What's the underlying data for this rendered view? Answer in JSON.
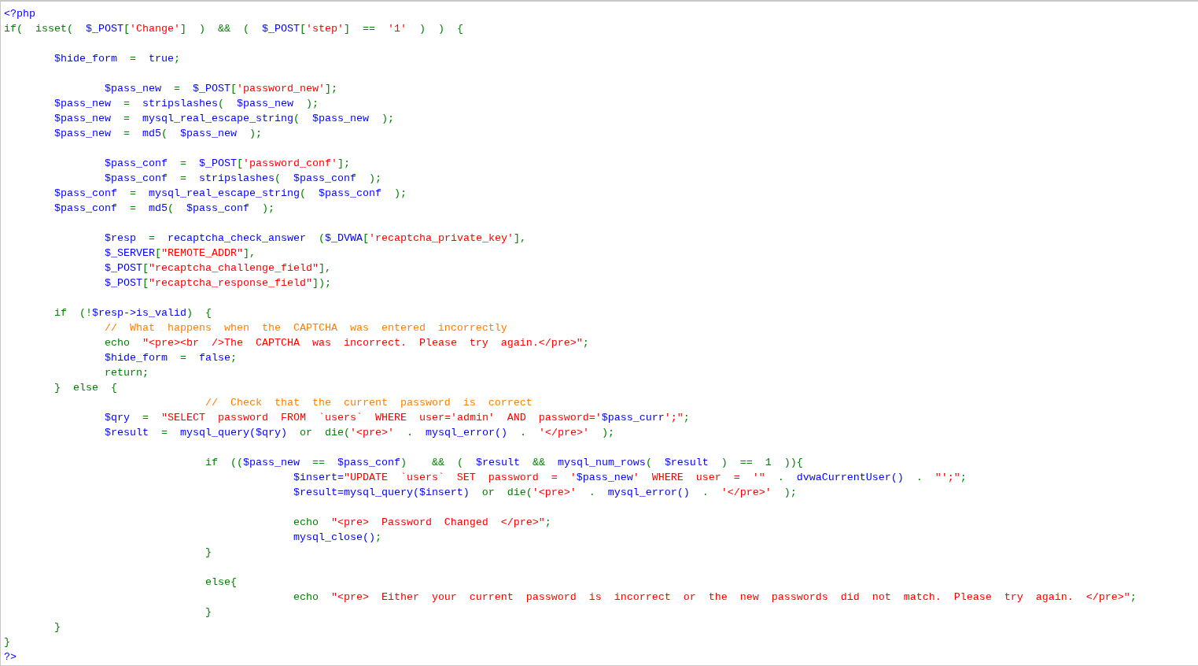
{
  "code_lines": [
    {
      "kind": "code",
      "tokens": [
        {
          "kind": "var",
          "text": "<?php"
        }
      ]
    },
    {
      "kind": "code",
      "tokens": [
        {
          "kind": "kw",
          "text": "if(  isset(  "
        },
        {
          "kind": "var",
          "text": "$_POST"
        },
        {
          "kind": "kw",
          "text": "["
        },
        {
          "kind": "str",
          "text": "'Change'"
        },
        {
          "kind": "kw",
          "text": "]  )  &&  (  "
        },
        {
          "kind": "var",
          "text": "$_POST"
        },
        {
          "kind": "kw",
          "text": "["
        },
        {
          "kind": "str",
          "text": "'step'"
        },
        {
          "kind": "kw",
          "text": "]  ==  "
        },
        {
          "kind": "str",
          "text": "'1'"
        },
        {
          "kind": "kw",
          "text": "  )  )  {"
        }
      ]
    },
    {
      "kind": "blank"
    },
    {
      "kind": "code",
      "tokens": [
        {
          "kind": "var",
          "text": "        $hide_form"
        },
        {
          "kind": "kw",
          "text": "  =  "
        },
        {
          "kind": "var",
          "text": "true"
        },
        {
          "kind": "kw",
          "text": ";"
        }
      ]
    },
    {
      "kind": "blank"
    },
    {
      "kind": "code",
      "tokens": [
        {
          "kind": "var",
          "text": "                $pass_new"
        },
        {
          "kind": "kw",
          "text": "  =  "
        },
        {
          "kind": "var",
          "text": "$_POST"
        },
        {
          "kind": "kw",
          "text": "["
        },
        {
          "kind": "str",
          "text": "'password_new'"
        },
        {
          "kind": "kw",
          "text": "];"
        }
      ]
    },
    {
      "kind": "code",
      "tokens": [
        {
          "kind": "var",
          "text": "        $pass_new"
        },
        {
          "kind": "kw",
          "text": "  =  "
        },
        {
          "kind": "var",
          "text": "stripslashes"
        },
        {
          "kind": "kw",
          "text": "(  "
        },
        {
          "kind": "var",
          "text": "$pass_new"
        },
        {
          "kind": "kw",
          "text": "  );"
        }
      ]
    },
    {
      "kind": "code",
      "tokens": [
        {
          "kind": "var",
          "text": "        $pass_new"
        },
        {
          "kind": "kw",
          "text": "  =  "
        },
        {
          "kind": "var",
          "text": "mysql_real_escape_string"
        },
        {
          "kind": "kw",
          "text": "(  "
        },
        {
          "kind": "var",
          "text": "$pass_new"
        },
        {
          "kind": "kw",
          "text": "  );"
        }
      ]
    },
    {
      "kind": "code",
      "tokens": [
        {
          "kind": "var",
          "text": "        $pass_new"
        },
        {
          "kind": "kw",
          "text": "  =  "
        },
        {
          "kind": "var",
          "text": "md5"
        },
        {
          "kind": "kw",
          "text": "(  "
        },
        {
          "kind": "var",
          "text": "$pass_new"
        },
        {
          "kind": "kw",
          "text": "  );"
        }
      ]
    },
    {
      "kind": "blank"
    },
    {
      "kind": "code",
      "tokens": [
        {
          "kind": "var",
          "text": "                $pass_conf"
        },
        {
          "kind": "kw",
          "text": "  =  "
        },
        {
          "kind": "var",
          "text": "$_POST"
        },
        {
          "kind": "kw",
          "text": "["
        },
        {
          "kind": "str",
          "text": "'password_conf'"
        },
        {
          "kind": "kw",
          "text": "];"
        }
      ]
    },
    {
      "kind": "code",
      "tokens": [
        {
          "kind": "var",
          "text": "                $pass_conf"
        },
        {
          "kind": "kw",
          "text": "  =  "
        },
        {
          "kind": "var",
          "text": "stripslashes"
        },
        {
          "kind": "kw",
          "text": "(  "
        },
        {
          "kind": "var",
          "text": "$pass_conf"
        },
        {
          "kind": "kw",
          "text": "  );"
        }
      ]
    },
    {
      "kind": "code",
      "tokens": [
        {
          "kind": "var",
          "text": "        $pass_conf"
        },
        {
          "kind": "kw",
          "text": "  =  "
        },
        {
          "kind": "var",
          "text": "mysql_real_escape_string"
        },
        {
          "kind": "kw",
          "text": "(  "
        },
        {
          "kind": "var",
          "text": "$pass_conf"
        },
        {
          "kind": "kw",
          "text": "  );"
        }
      ]
    },
    {
      "kind": "code",
      "tokens": [
        {
          "kind": "var",
          "text": "        $pass_conf"
        },
        {
          "kind": "kw",
          "text": "  =  "
        },
        {
          "kind": "var",
          "text": "md5"
        },
        {
          "kind": "kw",
          "text": "(  "
        },
        {
          "kind": "var",
          "text": "$pass_conf"
        },
        {
          "kind": "kw",
          "text": "  );"
        }
      ]
    },
    {
      "kind": "blank"
    },
    {
      "kind": "code",
      "tokens": [
        {
          "kind": "var",
          "text": "                $resp"
        },
        {
          "kind": "kw",
          "text": "  =  "
        },
        {
          "kind": "var",
          "text": "recaptcha_check_answer"
        },
        {
          "kind": "kw",
          "text": "  ("
        },
        {
          "kind": "var",
          "text": "$_DVWA"
        },
        {
          "kind": "kw",
          "text": "["
        },
        {
          "kind": "str",
          "text": "'recaptcha_private_key'"
        },
        {
          "kind": "kw",
          "text": "],"
        }
      ]
    },
    {
      "kind": "code",
      "tokens": [
        {
          "kind": "var",
          "text": "                $_SERVER"
        },
        {
          "kind": "kw",
          "text": "["
        },
        {
          "kind": "str",
          "text": "\"REMOTE_ADDR\""
        },
        {
          "kind": "kw",
          "text": "],"
        }
      ]
    },
    {
      "kind": "code",
      "tokens": [
        {
          "kind": "var",
          "text": "                $_POST"
        },
        {
          "kind": "kw",
          "text": "["
        },
        {
          "kind": "str",
          "text": "\"recaptcha_challenge_field\""
        },
        {
          "kind": "kw",
          "text": "],"
        }
      ]
    },
    {
      "kind": "code",
      "tokens": [
        {
          "kind": "var",
          "text": "                $_POST"
        },
        {
          "kind": "kw",
          "text": "["
        },
        {
          "kind": "str",
          "text": "\"recaptcha_response_field\""
        },
        {
          "kind": "kw",
          "text": "]);"
        }
      ]
    },
    {
      "kind": "blank"
    },
    {
      "kind": "code",
      "tokens": [
        {
          "kind": "kw",
          "text": "        if  (!"
        },
        {
          "kind": "var",
          "text": "$resp->is_valid"
        },
        {
          "kind": "kw",
          "text": ")  {"
        }
      ]
    },
    {
      "kind": "code",
      "tokens": [
        {
          "kind": "comment",
          "text": "                //  What  happens  when  the  CAPTCHA  was  entered  incorrectly"
        }
      ]
    },
    {
      "kind": "code",
      "tokens": [
        {
          "kind": "kw",
          "text": "                echo  "
        },
        {
          "kind": "str",
          "text": "\"<pre><br  />The  CAPTCHA  was  incorrect.  Please  try  again.</pre>\""
        },
        {
          "kind": "kw",
          "text": ";"
        }
      ]
    },
    {
      "kind": "code",
      "tokens": [
        {
          "kind": "var",
          "text": "                $hide_form"
        },
        {
          "kind": "kw",
          "text": "  =  "
        },
        {
          "kind": "var",
          "text": "false"
        },
        {
          "kind": "kw",
          "text": ";"
        }
      ]
    },
    {
      "kind": "code",
      "tokens": [
        {
          "kind": "kw",
          "text": "                return;"
        }
      ]
    },
    {
      "kind": "code",
      "tokens": [
        {
          "kind": "kw",
          "text": "        }  else  {"
        }
      ]
    },
    {
      "kind": "code",
      "tokens": [
        {
          "kind": "comment",
          "text": "                                //  Check  that  the  current  password  is  correct"
        }
      ]
    },
    {
      "kind": "code",
      "tokens": [
        {
          "kind": "var",
          "text": "                $qry"
        },
        {
          "kind": "kw",
          "text": "  =  "
        },
        {
          "kind": "str",
          "text": "\"SELECT  password  FROM  `users`  WHERE  user='admin'  AND  password='"
        },
        {
          "kind": "var",
          "text": "$pass_curr"
        },
        {
          "kind": "str",
          "text": "';\""
        },
        {
          "kind": "kw",
          "text": ";"
        }
      ]
    },
    {
      "kind": "code",
      "tokens": [
        {
          "kind": "var",
          "text": "                $result"
        },
        {
          "kind": "kw",
          "text": "  =  "
        },
        {
          "kind": "var",
          "text": "mysql_query($qry)"
        },
        {
          "kind": "kw",
          "text": "  or  die("
        },
        {
          "kind": "str",
          "text": "'<pre>'"
        },
        {
          "kind": "kw",
          "text": "  .  "
        },
        {
          "kind": "var",
          "text": "mysql_error()"
        },
        {
          "kind": "kw",
          "text": "  .  "
        },
        {
          "kind": "str",
          "text": "'</pre>'"
        },
        {
          "kind": "kw",
          "text": "  );"
        }
      ]
    },
    {
      "kind": "blank"
    },
    {
      "kind": "code",
      "tokens": [
        {
          "kind": "kw",
          "text": "                                if  (("
        },
        {
          "kind": "var",
          "text": "$pass_new"
        },
        {
          "kind": "kw",
          "text": "  ==  "
        },
        {
          "kind": "var",
          "text": "$pass_conf"
        },
        {
          "kind": "kw",
          "text": ")    &&  (  "
        },
        {
          "kind": "var",
          "text": "$result"
        },
        {
          "kind": "kw",
          "text": "  &&  "
        },
        {
          "kind": "var",
          "text": "mysql_num_rows"
        },
        {
          "kind": "kw",
          "text": "(  "
        },
        {
          "kind": "var",
          "text": "$result"
        },
        {
          "kind": "kw",
          "text": "  )  ==  1  )){"
        }
      ]
    },
    {
      "kind": "code",
      "tokens": [
        {
          "kind": "var",
          "text": "                                              $insert="
        },
        {
          "kind": "str",
          "text": "\"UPDATE  `users`  SET  password  =  '"
        },
        {
          "kind": "var",
          "text": "$pass_new"
        },
        {
          "kind": "str",
          "text": "'  WHERE  user  =  '\""
        },
        {
          "kind": "kw",
          "text": "  .  "
        },
        {
          "kind": "var",
          "text": "dvwaCurrentUser()"
        },
        {
          "kind": "kw",
          "text": "  .  "
        },
        {
          "kind": "str",
          "text": "\"';\""
        },
        {
          "kind": "kw",
          "text": ";"
        }
      ]
    },
    {
      "kind": "code",
      "tokens": [
        {
          "kind": "var",
          "text": "                                              $result=mysql_query($insert)"
        },
        {
          "kind": "kw",
          "text": "  or  die("
        },
        {
          "kind": "str",
          "text": "'<pre>'"
        },
        {
          "kind": "kw",
          "text": "  .  "
        },
        {
          "kind": "var",
          "text": "mysql_error()"
        },
        {
          "kind": "kw",
          "text": "  .  "
        },
        {
          "kind": "str",
          "text": "'</pre>'"
        },
        {
          "kind": "kw",
          "text": "  );"
        }
      ]
    },
    {
      "kind": "blank"
    },
    {
      "kind": "code",
      "tokens": [
        {
          "kind": "kw",
          "text": "                                              echo  "
        },
        {
          "kind": "str",
          "text": "\"<pre>  Password  Changed  </pre>\""
        },
        {
          "kind": "kw",
          "text": ";"
        }
      ]
    },
    {
      "kind": "code",
      "tokens": [
        {
          "kind": "var",
          "text": "                                              mysql_close()"
        },
        {
          "kind": "kw",
          "text": ";"
        }
      ]
    },
    {
      "kind": "code",
      "tokens": [
        {
          "kind": "kw",
          "text": "                                }"
        }
      ]
    },
    {
      "kind": "blank"
    },
    {
      "kind": "code",
      "tokens": [
        {
          "kind": "kw",
          "text": "                                else{"
        }
      ]
    },
    {
      "kind": "code",
      "tokens": [
        {
          "kind": "kw",
          "text": "                                              echo  "
        },
        {
          "kind": "str",
          "text": "\"<pre>  Either  your  current  password  is  incorrect  or  the  new  passwords  did  not  match.  Please  try  again.  </pre>\""
        },
        {
          "kind": "kw",
          "text": ";"
        }
      ]
    },
    {
      "kind": "code",
      "tokens": [
        {
          "kind": "kw",
          "text": "                                }"
        }
      ]
    },
    {
      "kind": "code",
      "tokens": [
        {
          "kind": "kw",
          "text": "        }"
        }
      ]
    },
    {
      "kind": "code",
      "tokens": [
        {
          "kind": "kw",
          "text": "}"
        }
      ]
    },
    {
      "kind": "code",
      "tokens": [
        {
          "kind": "var",
          "text": "?>"
        }
      ]
    }
  ]
}
